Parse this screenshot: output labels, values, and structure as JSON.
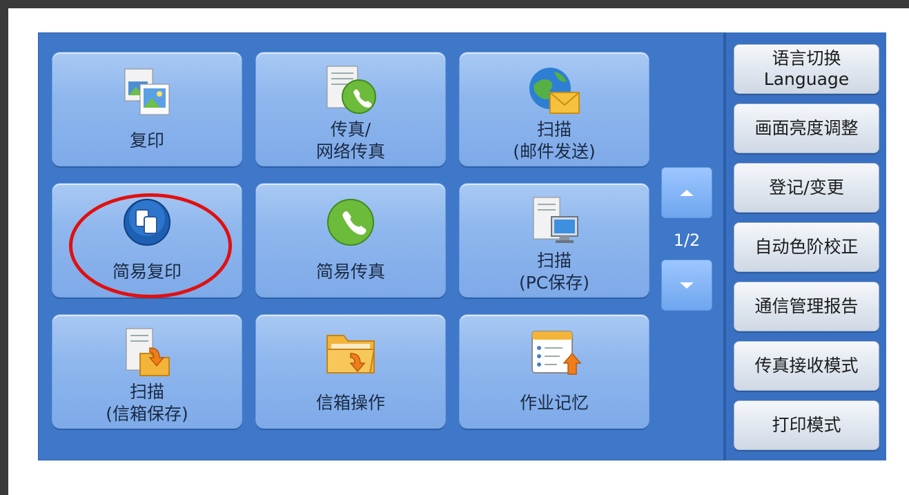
{
  "tiles": [
    {
      "label": "复印",
      "icon": "copy-icon"
    },
    {
      "label": "传真/\n网络传真",
      "icon": "fax-internet-fax-icon"
    },
    {
      "label": "扫描\n(邮件发送)",
      "icon": "scan-email-icon"
    },
    {
      "label": "简易复印",
      "icon": "simple-copy-icon"
    },
    {
      "label": "简易传真",
      "icon": "simple-fax-icon"
    },
    {
      "label": "扫描\n(PC保存)",
      "icon": "scan-pc-icon"
    },
    {
      "label": "扫描\n(信箱保存)",
      "icon": "scan-mailbox-icon"
    },
    {
      "label": "信箱操作",
      "icon": "mailbox-operation-icon"
    },
    {
      "label": "作业记忆",
      "icon": "job-memory-icon"
    }
  ],
  "pager": {
    "indicator": "1/2",
    "up_icon": "arrow-up-icon",
    "down_icon": "arrow-down-icon"
  },
  "sidebar": [
    {
      "label": "语言切换\nLanguage"
    },
    {
      "label": "画面亮度调整"
    },
    {
      "label": "登记/变更"
    },
    {
      "label": "自动色阶校正"
    },
    {
      "label": "通信管理报告"
    },
    {
      "label": "传真接收模式"
    },
    {
      "label": "打印模式"
    }
  ],
  "colors": {
    "panel": "#3f78c9",
    "highlight_circle": "#e01010"
  }
}
